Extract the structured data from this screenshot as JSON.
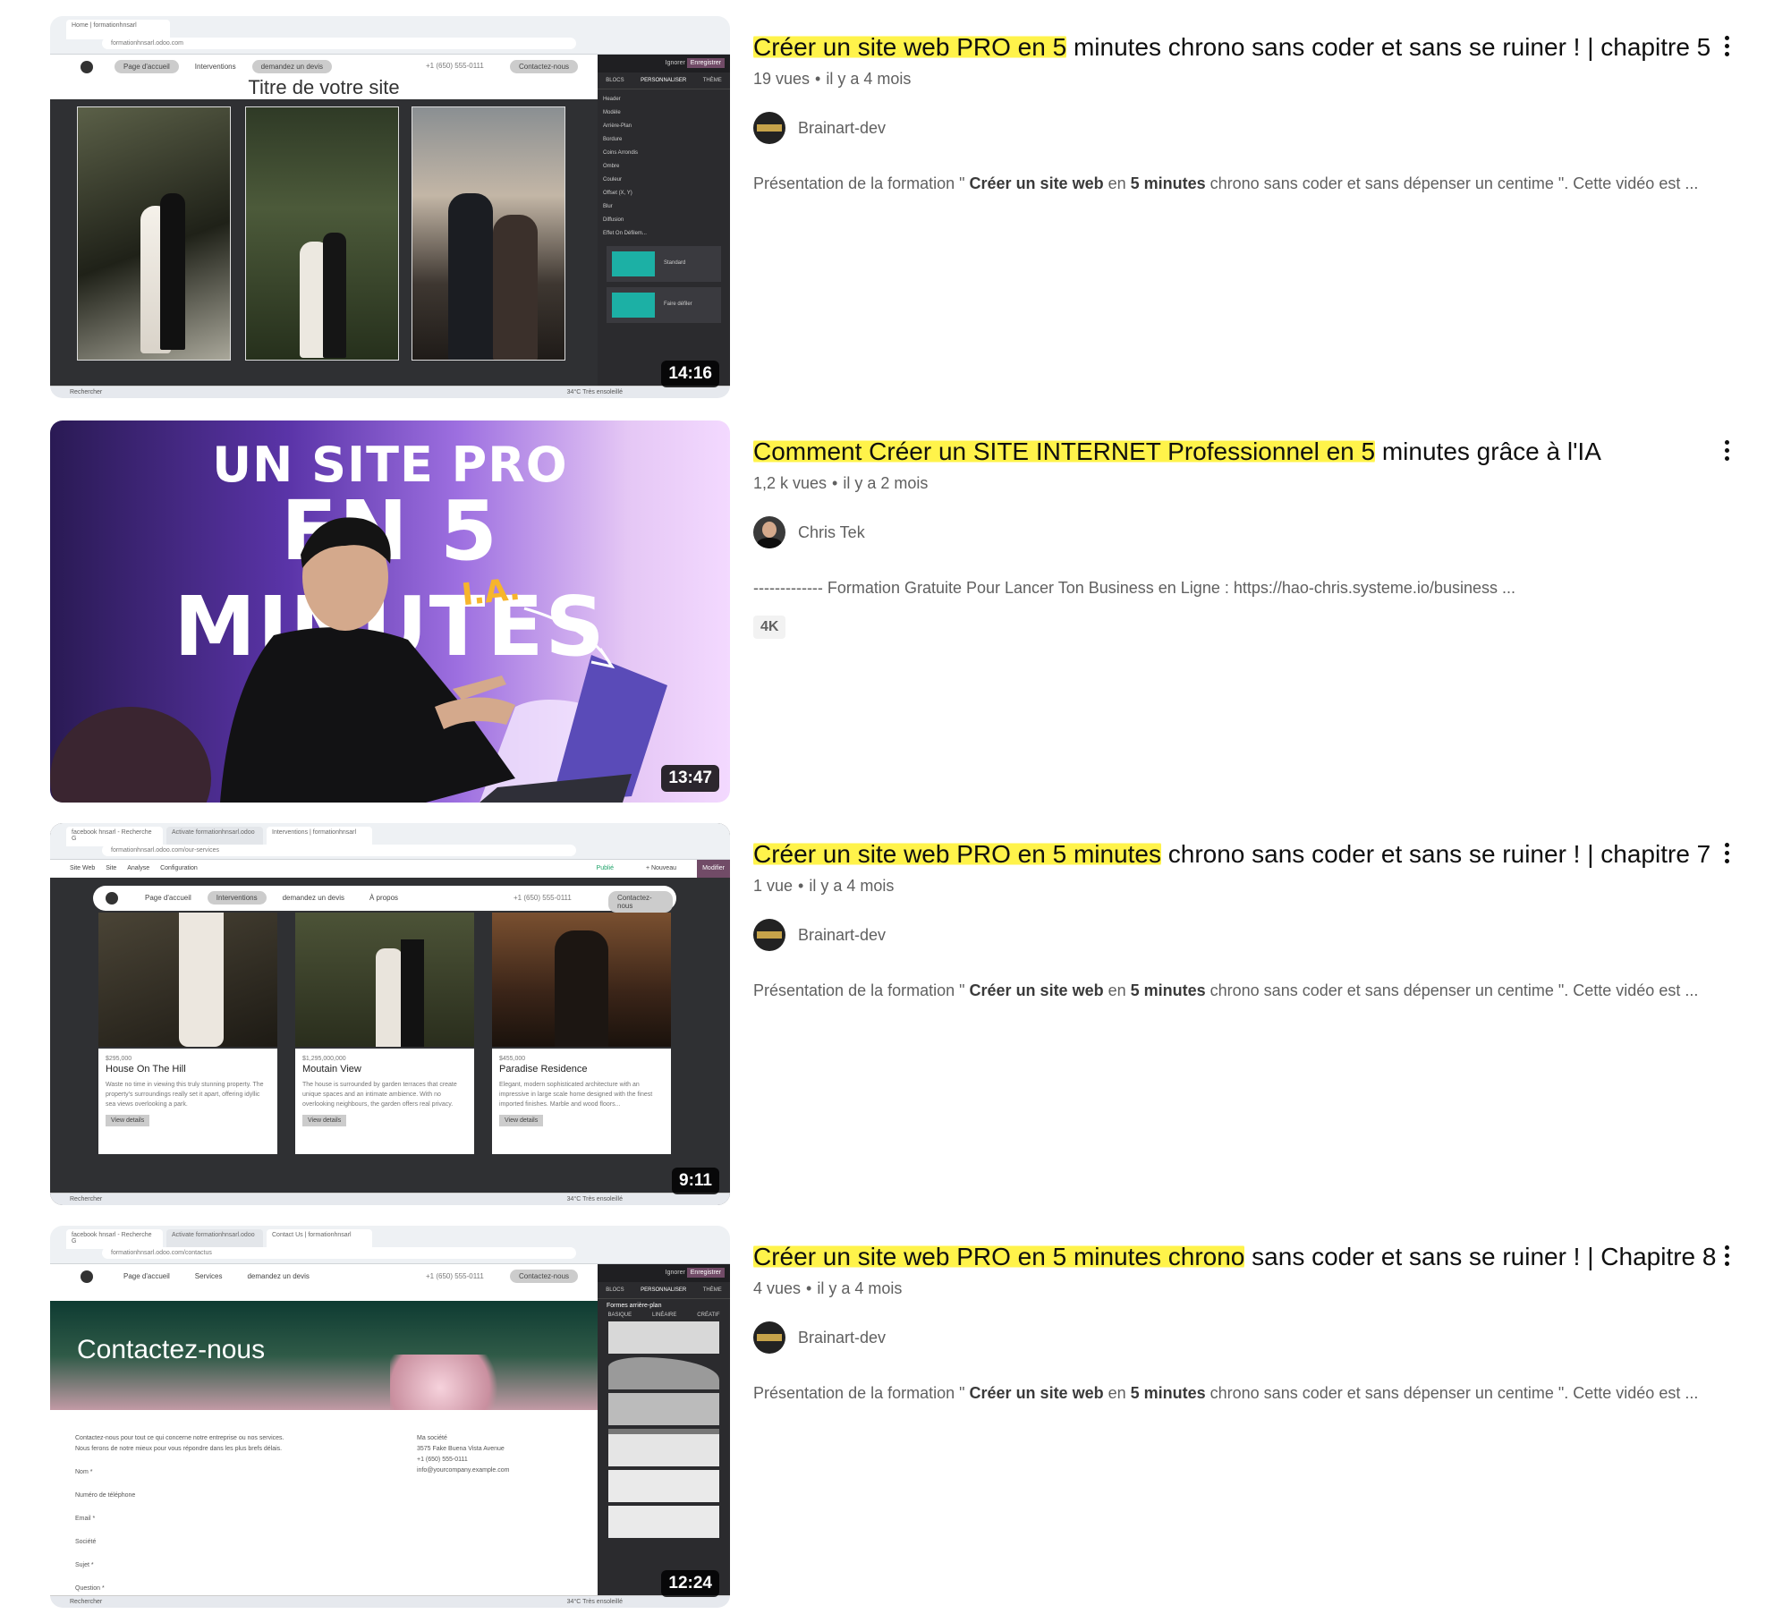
{
  "results": [
    {
      "title_highlight": "Créer un site web PRO en 5",
      "title_rest": " minutes chrono sans coder et sans se ruiner ! | chapitre 5",
      "views": "19 vues",
      "age": "il y a 4 mois",
      "channel": "Brainart-dev",
      "desc_parts": [
        "Présentation de la formation \" ",
        "Créer un site web",
        " en ",
        "5 minutes",
        " chrono sans coder et sans dépenser un centime \". Cette vidéo est ..."
      ],
      "duration": "14:16",
      "thumb": {
        "url": "formationhnsarl.odoo.com",
        "tab": "Home | formationhnsarl",
        "nav": [
          "Page d'accueil",
          "Interventions",
          "demandez un devis"
        ],
        "cta": "Contactez-nous",
        "phone": "+1 (650) 555-0111",
        "heading": "Titre de votre site",
        "panel_tabs": [
          "BLOCS",
          "PERSONNALISER",
          "THÈME"
        ],
        "panel_buttons": [
          "Ignorer",
          "Enregistrer"
        ],
        "panel_rows": [
          "Header",
          "Modèle",
          "Arrière-Plan",
          "Bordure",
          "Coins Arrondis",
          "Ombre",
          "Couleur",
          "Offset (X, Y)",
          "Blur",
          "Diffusion",
          "Effet On Défilem..."
        ],
        "panel_labels": [
          "Standard",
          "Faire défiler"
        ],
        "taskbar_search": "Rechercher",
        "weather": "34°C  Très ensoleillé"
      }
    },
    {
      "title_highlight": "Comment Créer un SITE INTERNET Professionnel en 5",
      "title_rest": " minutes grâce à l'IA",
      "views": "1,2 k vues",
      "age": "il y a 2 mois",
      "channel": "Chris Tek",
      "desc_plain": "------------- Formation Gratuite Pour Lancer Ton Business en Ligne : https://hao-chris.systeme.io/business ...",
      "badge": "4K",
      "duration": "13:47",
      "thumb": {
        "line1": "UN SITE PRO",
        "line2": "EN 5 MINUTES",
        "tag": "I.A."
      }
    },
    {
      "title_highlight": "Créer un site web PRO en 5 minutes",
      "title_rest": " chrono sans coder et sans se ruiner ! | chapitre 7",
      "views": "1 vue",
      "age": "il y a 4 mois",
      "channel": "Brainart-dev",
      "desc_parts": [
        "Présentation de la formation \" ",
        "Créer un site web",
        " en ",
        "5 minutes",
        " chrono sans coder et sans dépenser un centime \". Cette vidéo est ..."
      ],
      "duration": "9:11",
      "thumb": {
        "url": "formationhnsarl.odoo.com/our-services",
        "tabs": [
          "facebook hnsarl - Recherche G",
          "Activate formationhnsarl.odoo",
          "Interventions | formationhnsarl"
        ],
        "bar": [
          "Site Web",
          "Site",
          "Analyse",
          "Configuration"
        ],
        "bar_right": [
          "Publié",
          "+ Nouveau",
          "Modifier"
        ],
        "nav": [
          "Page d'accueil",
          "Interventions",
          "demandez un devis",
          "À propos"
        ],
        "cta": "Contactez-nous",
        "phone": "+1 (650) 555-0111",
        "cards": [
          {
            "price": "$295,000",
            "name": "House On The Hill",
            "text": "Waste no time in viewing this truly stunning property. The property's surroundings really set it apart, offering idyllic sea views overlooking a park.",
            "btn": "View details"
          },
          {
            "price": "$1,295,000,000",
            "name": "Moutain View",
            "text": "The house is surrounded by garden terraces that create unique spaces and an intimate ambience. With no overlooking neighbours, the garden offers real privacy.",
            "btn": "View details"
          },
          {
            "price": "$455,000",
            "name": "Paradise Residence",
            "text": "Elegant, modern sophisticated architecture with an impressive in large scale home designed with the finest imported finishes. Marble and wood floors...",
            "btn": "View details"
          }
        ],
        "taskbar_search": "Rechercher",
        "weather": "34°C  Très ensoleillé"
      }
    },
    {
      "title_highlight": "Créer un site web PRO en 5 minutes chrono",
      "title_rest": " sans coder et sans se ruiner ! | Chapitre 8",
      "views": "4 vues",
      "age": "il y a 4 mois",
      "channel": "Brainart-dev",
      "desc_parts": [
        "Présentation de la formation \" ",
        "Créer un site web",
        " en ",
        "5 minutes",
        " chrono sans coder et sans dépenser un centime \". Cette vidéo est ..."
      ],
      "duration": "12:24",
      "thumb": {
        "url": "formationhnsarl.odoo.com/contactus",
        "tabs": [
          "facebook hnsarl - Recherche G",
          "Activate formationhnsarl.odoo",
          "Contact Us | formationhnsarl"
        ],
        "nav": [
          "Page d'accueil",
          "Services",
          "demandez un devis"
        ],
        "cta": "Contactez-nous",
        "phone": "+1 (650) 555-0111",
        "hero": "Contactez-nous",
        "intro1": "Contactez-nous pour tout ce qui concerne notre entreprise ou nos services.",
        "intro2": "Nous ferons de notre mieux pour vous répondre dans les plus brefs délais.",
        "fields": [
          "Nom *",
          "Numéro de téléphone",
          "Email *",
          "Société",
          "Sujet *",
          "Question *"
        ],
        "company": "Ma société",
        "address": "3575 Fake Buena Vista Avenue",
        "company_phone": "+1 (650) 555-0111",
        "email": "info@yourcompany.example.com",
        "panel_buttons": [
          "Ignorer",
          "Enregistrer"
        ],
        "panel_tabs": [
          "BLOCS",
          "PERSONNALISER",
          "THÈME"
        ],
        "panel_title": "Formes arrière-plan",
        "panel_subtabs": [
          "BASIQUE",
          "LINÉAIRE",
          "CRÉATIF"
        ],
        "taskbar_search": "Rechercher",
        "weather": "34°C  Très ensoleillé"
      }
    }
  ],
  "colors": {
    "highlight": "#fff34a",
    "text": "#0f0f0f",
    "muted": "#606060"
  }
}
